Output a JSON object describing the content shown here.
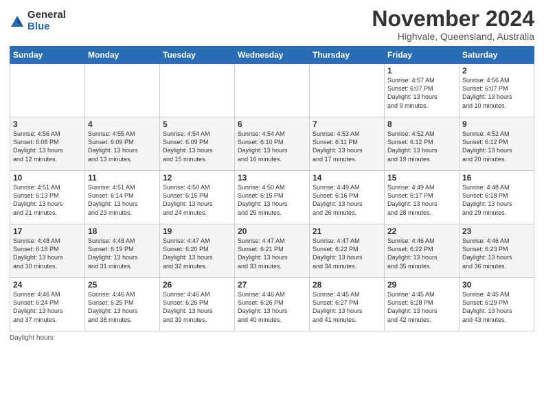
{
  "logo": {
    "general": "General",
    "blue": "Blue"
  },
  "title": "November 2024",
  "location": "Highvale, Queensland, Australia",
  "days_header": [
    "Sunday",
    "Monday",
    "Tuesday",
    "Wednesday",
    "Thursday",
    "Friday",
    "Saturday"
  ],
  "weeks": [
    [
      {
        "day": "",
        "info": ""
      },
      {
        "day": "",
        "info": ""
      },
      {
        "day": "",
        "info": ""
      },
      {
        "day": "",
        "info": ""
      },
      {
        "day": "",
        "info": ""
      },
      {
        "day": "1",
        "info": "Sunrise: 4:57 AM\nSunset: 6:07 PM\nDaylight: 13 hours\nand 9 minutes."
      },
      {
        "day": "2",
        "info": "Sunrise: 4:56 AM\nSunset: 6:07 PM\nDaylight: 13 hours\nand 10 minutes."
      }
    ],
    [
      {
        "day": "3",
        "info": "Sunrise: 4:56 AM\nSunset: 6:08 PM\nDaylight: 13 hours\nand 12 minutes."
      },
      {
        "day": "4",
        "info": "Sunrise: 4:55 AM\nSunset: 6:09 PM\nDaylight: 13 hours\nand 13 minutes."
      },
      {
        "day": "5",
        "info": "Sunrise: 4:54 AM\nSunset: 6:09 PM\nDaylight: 13 hours\nand 15 minutes."
      },
      {
        "day": "6",
        "info": "Sunrise: 4:54 AM\nSunset: 6:10 PM\nDaylight: 13 hours\nand 16 minutes."
      },
      {
        "day": "7",
        "info": "Sunrise: 4:53 AM\nSunset: 6:11 PM\nDaylight: 13 hours\nand 17 minutes."
      },
      {
        "day": "8",
        "info": "Sunrise: 4:52 AM\nSunset: 6:12 PM\nDaylight: 13 hours\nand 19 minutes."
      },
      {
        "day": "9",
        "info": "Sunrise: 4:52 AM\nSunset: 6:12 PM\nDaylight: 13 hours\nand 20 minutes."
      }
    ],
    [
      {
        "day": "10",
        "info": "Sunrise: 4:51 AM\nSunset: 6:13 PM\nDaylight: 13 hours\nand 21 minutes."
      },
      {
        "day": "11",
        "info": "Sunrise: 4:51 AM\nSunset: 6:14 PM\nDaylight: 13 hours\nand 23 minutes."
      },
      {
        "day": "12",
        "info": "Sunrise: 4:50 AM\nSunset: 6:15 PM\nDaylight: 13 hours\nand 24 minutes."
      },
      {
        "day": "13",
        "info": "Sunrise: 4:50 AM\nSunset: 6:15 PM\nDaylight: 13 hours\nand 25 minutes."
      },
      {
        "day": "14",
        "info": "Sunrise: 4:49 AM\nSunset: 6:16 PM\nDaylight: 13 hours\nand 26 minutes."
      },
      {
        "day": "15",
        "info": "Sunrise: 4:49 AM\nSunset: 6:17 PM\nDaylight: 13 hours\nand 28 minutes."
      },
      {
        "day": "16",
        "info": "Sunrise: 4:48 AM\nSunset: 6:18 PM\nDaylight: 13 hours\nand 29 minutes."
      }
    ],
    [
      {
        "day": "17",
        "info": "Sunrise: 4:48 AM\nSunset: 6:18 PM\nDaylight: 13 hours\nand 30 minutes."
      },
      {
        "day": "18",
        "info": "Sunrise: 4:48 AM\nSunset: 6:19 PM\nDaylight: 13 hours\nand 31 minutes."
      },
      {
        "day": "19",
        "info": "Sunrise: 4:47 AM\nSunset: 6:20 PM\nDaylight: 13 hours\nand 32 minutes."
      },
      {
        "day": "20",
        "info": "Sunrise: 4:47 AM\nSunset: 6:21 PM\nDaylight: 13 hours\nand 33 minutes."
      },
      {
        "day": "21",
        "info": "Sunrise: 4:47 AM\nSunset: 6:22 PM\nDaylight: 13 hours\nand 34 minutes."
      },
      {
        "day": "22",
        "info": "Sunrise: 4:46 AM\nSunset: 6:22 PM\nDaylight: 13 hours\nand 35 minutes."
      },
      {
        "day": "23",
        "info": "Sunrise: 4:46 AM\nSunset: 6:23 PM\nDaylight: 13 hours\nand 36 minutes."
      }
    ],
    [
      {
        "day": "24",
        "info": "Sunrise: 4:46 AM\nSunset: 6:24 PM\nDaylight: 13 hours\nand 37 minutes."
      },
      {
        "day": "25",
        "info": "Sunrise: 4:46 AM\nSunset: 6:25 PM\nDaylight: 13 hours\nand 38 minutes."
      },
      {
        "day": "26",
        "info": "Sunrise: 4:46 AM\nSunset: 6:26 PM\nDaylight: 13 hours\nand 39 minutes."
      },
      {
        "day": "27",
        "info": "Sunrise: 4:46 AM\nSunset: 6:26 PM\nDaylight: 13 hours\nand 40 minutes."
      },
      {
        "day": "28",
        "info": "Sunrise: 4:45 AM\nSunset: 6:27 PM\nDaylight: 13 hours\nand 41 minutes."
      },
      {
        "day": "29",
        "info": "Sunrise: 4:45 AM\nSunset: 6:28 PM\nDaylight: 13 hours\nand 42 minutes."
      },
      {
        "day": "30",
        "info": "Sunrise: 4:45 AM\nSunset: 6:29 PM\nDaylight: 13 hours\nand 43 minutes."
      }
    ]
  ],
  "footer": "Daylight hours"
}
